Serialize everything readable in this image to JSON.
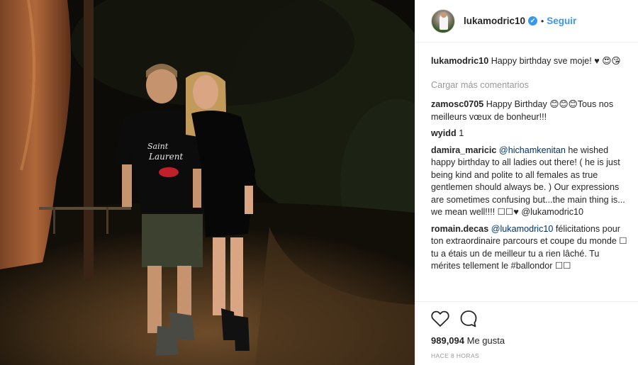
{
  "post": {
    "username": "lukamodric10",
    "verified_badge": "✔",
    "dot": "•",
    "follow_label": "Seguir",
    "caption": {
      "user": "lukamodric10",
      "text": "Happy birthday sve moje! ♥ 😍😘"
    },
    "load_more_label": "Cargar más comentarios",
    "comments": [
      {
        "user": "zamosc0705",
        "text": "Happy Birthday 😊😊😊Tous nos meilleurs vœux de bonheur!!!",
        "mention": "",
        "text_after": ""
      },
      {
        "user": "wyidd",
        "text": "1",
        "mention": "",
        "text_after": ""
      },
      {
        "user": "damira_maricic",
        "text": "",
        "mention": "@hichamkenitan",
        "text_after": " he wished happy birthday to all ladies out there! ( he is just being kind and polite to all females as true gentlemen should always be. ) Our expressions are sometimes confusing but...the main thing is... we mean well!!!! ☐☐♥ @lukamodric10"
      },
      {
        "user": "romain.decas",
        "text": "",
        "mention": "@lukamodric10",
        "text_after": " félicitations pour ton extraordinaire parcours et coupe du monde ☐ tu a étais un de meilleur tu a rien lâché. Tu mérites tellement le #ballondor ☐☐"
      }
    ],
    "likes_count": "989,094",
    "likes_label": "Me gusta",
    "time_ago": "HACE 8 HORAS"
  },
  "icons": {
    "like": "heart-icon",
    "comment": "comment-bubble-icon",
    "verified": "verified-badge-icon"
  },
  "colors": {
    "accent": "#3897f0",
    "mention": "#003569",
    "muted": "#999999",
    "text": "#262626",
    "border": "#efefef"
  }
}
